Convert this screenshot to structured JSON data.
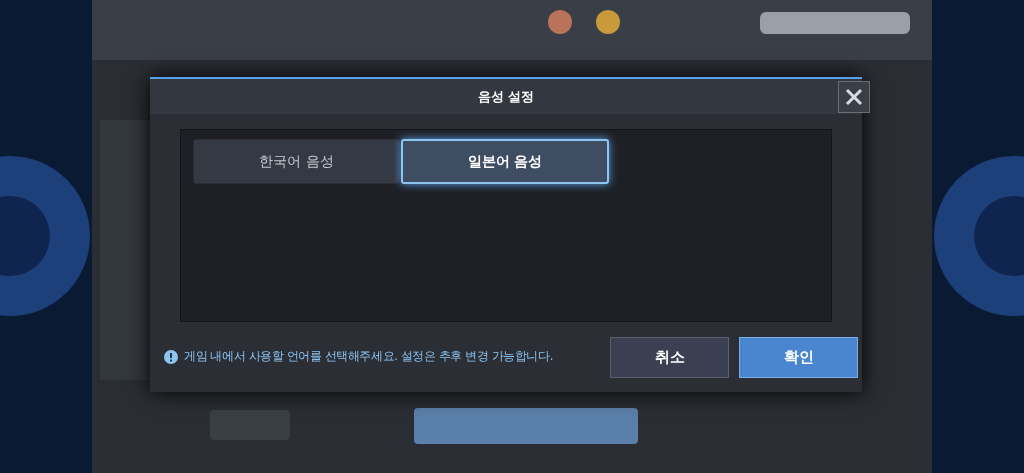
{
  "dialog": {
    "title": "음성 설정",
    "tabs": [
      {
        "label": "한국어 음성",
        "selected": false
      },
      {
        "label": "일본어 음성",
        "selected": true
      }
    ],
    "notice": "게임 내에서 사용할 언어를 선택해주세요. 설정은 추후 변경 가능합니다.",
    "buttons": [
      {
        "label": "취소",
        "kind": "secondary"
      },
      {
        "label": "확인",
        "kind": "primary"
      }
    ]
  }
}
